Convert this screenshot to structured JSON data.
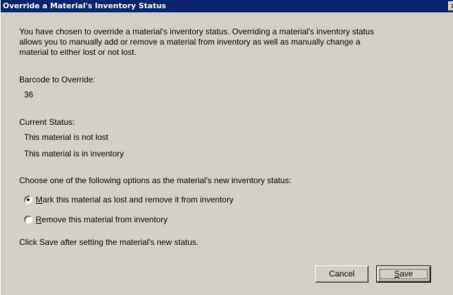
{
  "window": {
    "title": "Override a Material's Inventory Status",
    "close_glyph": "×"
  },
  "intro": {
    "line1": "You have chosen to override a material's inventory status.  Overriding a material's inventory status",
    "line2": "allows you to manually add or remove a material from inventory as well as manually change a",
    "line3": "material to either lost or not lost."
  },
  "barcode": {
    "label": "Barcode to Override:",
    "value": "36"
  },
  "current_status": {
    "label": "Current Status:",
    "lost_status": "This material is not lost",
    "inventory_status": "This material is in inventory"
  },
  "options": {
    "prompt": "Choose one of the following options as the material's new inventory status:",
    "items": [
      {
        "mnemonic": "M",
        "rest": "ark this material as lost and remove it from inventory",
        "selected": true
      },
      {
        "mnemonic": "R",
        "rest": "emove this material from inventory",
        "selected": false
      }
    ]
  },
  "footer_hint": "Click Save after setting the material's new status.",
  "buttons": {
    "cancel_label": "Cancel",
    "save_mnemonic": "S",
    "save_rest": "ave"
  },
  "icons": {
    "close": "close-icon",
    "radio_selected": "radio-selected",
    "radio_unselected": "radio-unselected"
  }
}
